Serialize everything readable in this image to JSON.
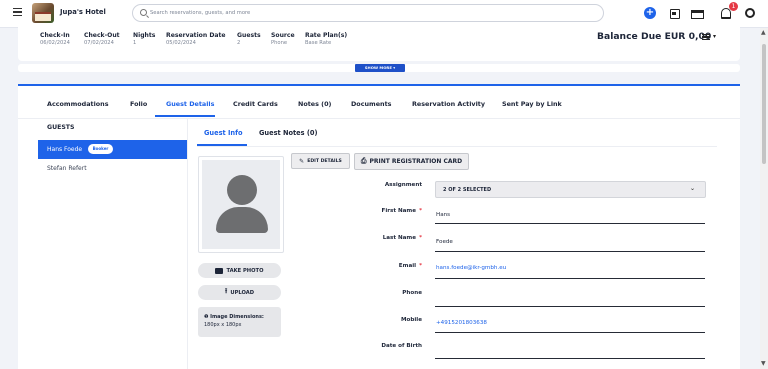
{
  "app": {
    "hotel_name": "Jupa's Hotel",
    "search_placeholder": "Search reservations, guests, and more",
    "notification_count": "1"
  },
  "reservation": {
    "headers": [
      "Check-In",
      "Check-Out",
      "Nights",
      "Reservation Date",
      "Guests",
      "Source",
      "Rate Plan(s)"
    ],
    "values": [
      "06/02/2024",
      "07/02/2024",
      "1",
      "05/02/2024",
      "2",
      "Phone",
      "Base Rate"
    ],
    "balance_label": "Balance Due EUR 0,00",
    "show_more_label": "SHOW MORE"
  },
  "tabs": [
    "Accommodations",
    "Folio",
    "Guest Details",
    "Credit Cards",
    "Notes (0)",
    "Documents",
    "Reservation Activity",
    "Sent Pay by Link"
  ],
  "active_tab": "Guest Details",
  "guests": {
    "heading": "GUESTS",
    "list": [
      {
        "name": "Hans Foede",
        "badge": "Booker",
        "selected": true
      },
      {
        "name": "Stefan Refert",
        "badge": "",
        "selected": false
      }
    ]
  },
  "subtabs": [
    "Guest Info",
    "Guest Notes (0)"
  ],
  "buttons": {
    "edit_details": "EDIT DETAILS",
    "print_card": "PRINT REGISTRATION CARD",
    "take_photo": "TAKE PHOTO",
    "upload": "UPLOAD"
  },
  "image_info": {
    "label": "Image Dimensions:",
    "value": "180px x 180px"
  },
  "form": {
    "assignment_label": "Assignment",
    "assignment_value": "2 OF 2 SELECTED",
    "first_name_label": "First Name",
    "first_name": "Hans",
    "last_name_label": "Last Name",
    "last_name": "Foede",
    "email_label": "Email",
    "email": "hans.foede@ikr-gmbh.eu",
    "phone_label": "Phone",
    "phone": "",
    "mobile_label": "Mobile",
    "mobile": "+4915201803638",
    "dob_label": "Date of Birth",
    "dob": "",
    "required_mark": "*"
  },
  "colors": {
    "accent": "#1e63e9",
    "badge": "#e53945"
  }
}
